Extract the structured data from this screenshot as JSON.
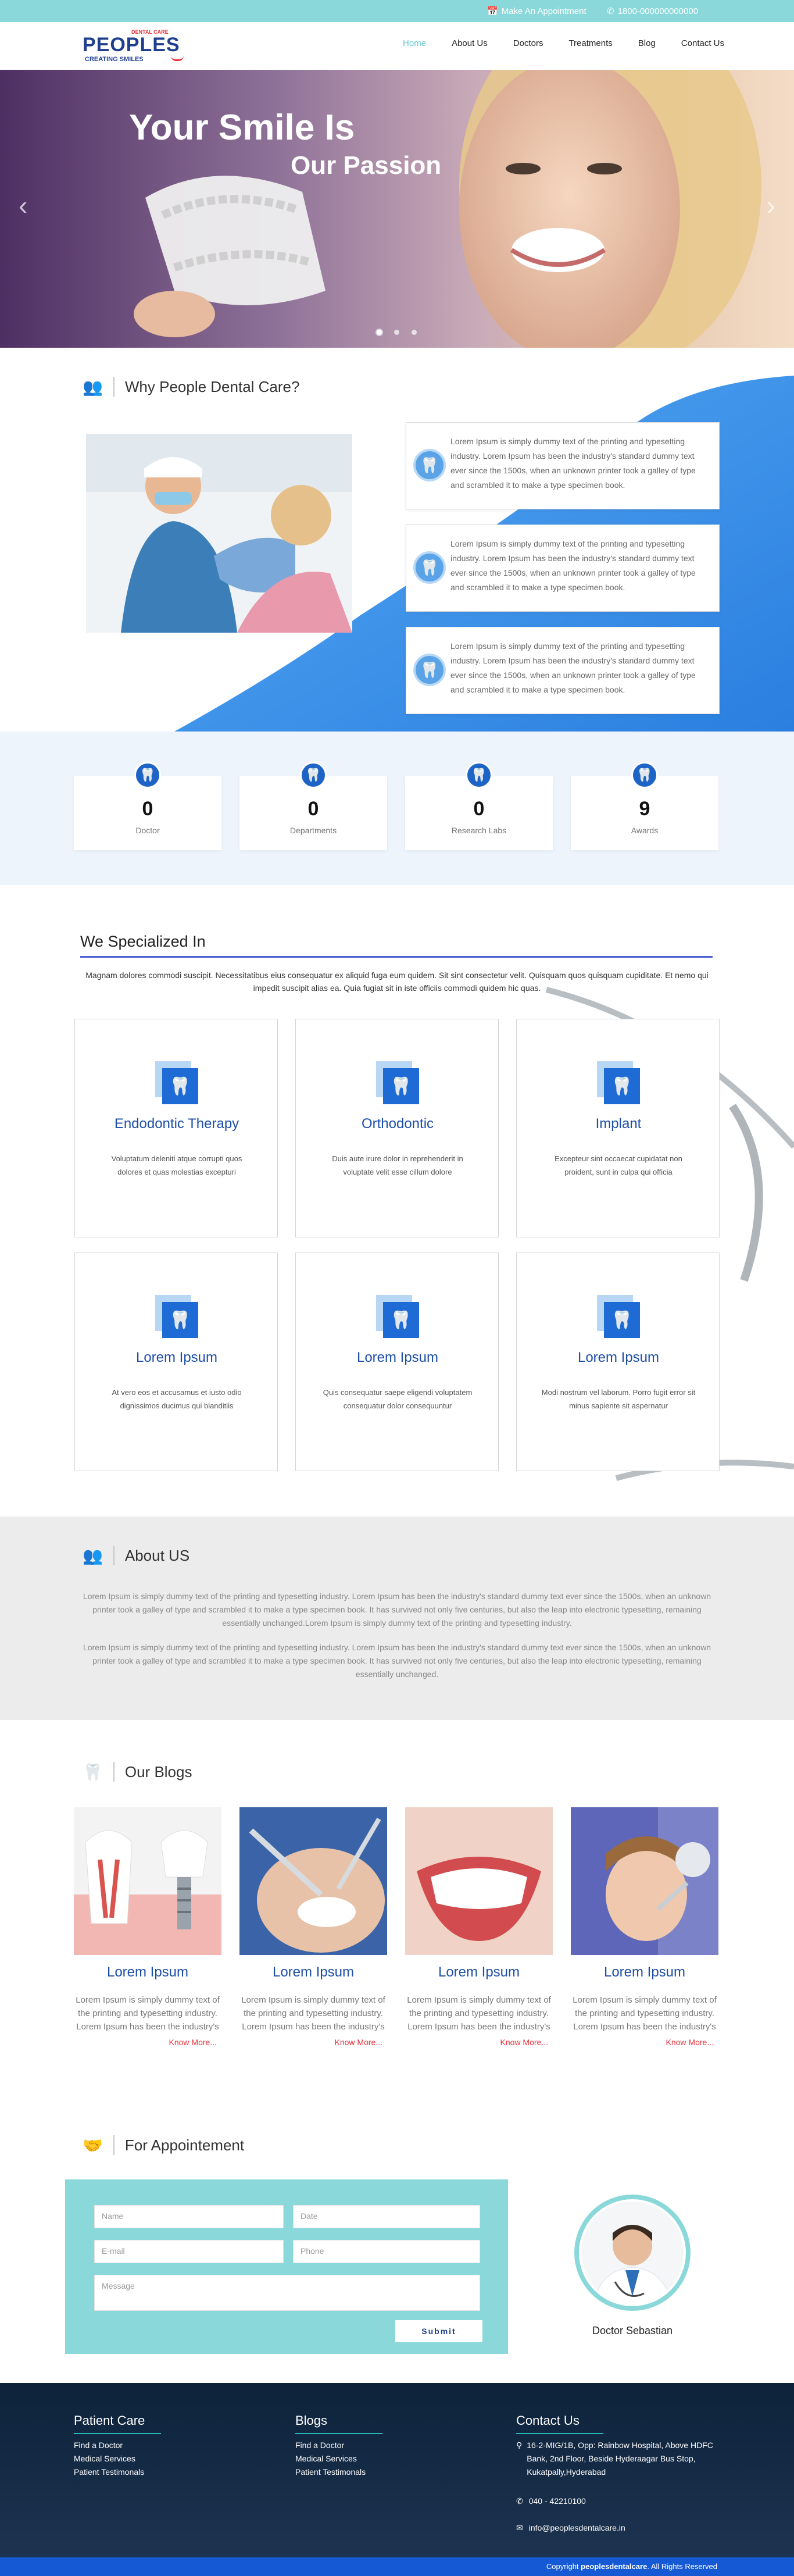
{
  "topbar": {
    "appointment": "Make An Appointment",
    "phone": "1800-000000000000"
  },
  "logo": {
    "tagline_top": "DENTAL CARE",
    "name": "PEOPLES",
    "tagline_bottom": "CREATING SMILES"
  },
  "nav": {
    "items": [
      "Home",
      "About Us",
      "Doctors",
      "Treatments",
      "Blog",
      "Contact Us"
    ],
    "active": "Home"
  },
  "hero": {
    "line1": "Your Smile Is",
    "line2": "Our Passion",
    "slides": 3,
    "active_slide": 1
  },
  "why": {
    "title": "Why People Dental Care?",
    "boxes": [
      "Lorem Ipsum is simply dummy text of the printing and typesetting industry. Lorem Ipsum has been the industry's standard dummy text ever since the 1500s, when an unknown printer took a galley of type and scrambled it to make a type specimen book.",
      "Lorem Ipsum is simply dummy text of the printing and typesetting industry. Lorem Ipsum has been the industry's standard dummy text ever since the 1500s, when an unknown printer took a galley of type and scrambled it to make a type specimen book.",
      "Lorem Ipsum is simply dummy text of the printing and typesetting industry. Lorem Ipsum has been the industry's standard dummy text ever since the 1500s, when an unknown printer took a galley of type and scrambled it to make a type specimen book."
    ]
  },
  "stats": [
    {
      "value": "0",
      "label": "Doctor"
    },
    {
      "value": "0",
      "label": "Departments"
    },
    {
      "value": "0",
      "label": "Research Labs"
    },
    {
      "value": "9",
      "label": "Awards"
    }
  ],
  "specialized": {
    "title": "We Specialized In",
    "intro": "Magnam dolores commodi suscipit. Necessitatibus eius consequatur ex aliquid fuga eum quidem. Sit sint consectetur velit. Quisquam quos quisquam cupiditate. Et nemo qui impedit suscipit alias ea. Quia fugiat sit in iste officiis commodi quidem hic quas.",
    "cards": [
      {
        "title": "Endodontic Therapy",
        "desc": "Voluptatum deleniti atque corrupti quos dolores et quas molestias excepturi"
      },
      {
        "title": "Orthodontic",
        "desc": "Duis aute irure dolor in reprehenderit in voluptate velit esse cillum dolore"
      },
      {
        "title": "Implant",
        "desc": "Excepteur sint occaecat cupidatat non proident, sunt in culpa qui officia"
      },
      {
        "title": "Lorem Ipsum",
        "desc": "At vero eos et accusamus et iusto odio dignissimos ducimus qui blanditiis"
      },
      {
        "title": "Lorem Ipsum",
        "desc": "Quis consequatur saepe eligendi voluptatem consequatur dolor consequuntur"
      },
      {
        "title": "Lorem Ipsum",
        "desc": "Modi nostrum vel laborum. Porro fugit error sit minus sapiente sit aspernatur"
      }
    ]
  },
  "about": {
    "title": "About US",
    "p1": "Lorem Ipsum is simply dummy text of the printing and typesetting industry. Lorem Ipsum has been the industry's standard dummy text ever since the 1500s, when an unknown printer took a galley of type and scrambled it to make a type specimen book. It has survived not only five centuries, but also the leap into electronic typesetting, remaining essentially unchanged.Lorem Ipsum is simply dummy text of the printing and typesetting industry.",
    "p2": "Lorem Ipsum is simply dummy text of the printing and typesetting industry. Lorem Ipsum has been the industry's standard dummy text ever since the 1500s, when an unknown printer took a galley of type and scrambled it to make a type specimen book. It has survived not only five centuries, but also the leap into electronic typesetting, remaining essentially unchanged."
  },
  "blogs": {
    "title": "Our Blogs",
    "posts": [
      {
        "title": "Lorem Ipsum",
        "text": "Lorem Ipsum is simply dummy text of the printing and typesetting industry. Lorem Ipsum has been the industry's",
        "more": "Know More..."
      },
      {
        "title": "Lorem Ipsum",
        "text": "Lorem Ipsum is simply dummy text of the printing and typesetting industry. Lorem Ipsum has been the industry's",
        "more": "Know More..."
      },
      {
        "title": "Lorem Ipsum",
        "text": "Lorem Ipsum is simply dummy text of the printing and typesetting industry. Lorem Ipsum has been the industry's",
        "more": "Know More..."
      },
      {
        "title": "Lorem Ipsum",
        "text": "Lorem Ipsum is simply dummy text of the printing and typesetting industry. Lorem Ipsum has been the industry's",
        "more": "Know More..."
      }
    ]
  },
  "appointment": {
    "title": "For Appointement",
    "name_ph": "Name",
    "date_ph": "Date",
    "email_ph": "E-mail",
    "phone_ph": "Phone",
    "message_ph": "Message",
    "submit": "Submit",
    "doctor": "Doctor Sebastian"
  },
  "footer": {
    "col1": {
      "title": "Patient Care",
      "items": [
        "Find a Doctor",
        "Medical Services",
        "Patient Testimonals"
      ]
    },
    "col2": {
      "title": "Blogs",
      "items": [
        "Find a Doctor",
        "Medical Services",
        "Patient Testimonals"
      ]
    },
    "col3": {
      "title": "Contact Us",
      "address": "16-2-MIG/1B, Opp: Rainbow Hospital, Above HDFC Bank, 2nd Floor, Beside Hyderaagar Bus Stop, Kukatpally,Hyderabad",
      "phone": "040 - 42210100",
      "email": "info@peoplesdentalcare.in"
    },
    "copyright_prefix": "Copyright",
    "copyright_brand": "peoplesdentalcare",
    "copyright_suffix": ". All Rights Reserved"
  },
  "colors": {
    "accent": "#8ad8da",
    "primary": "#1e63c6",
    "link": "#e8323c"
  }
}
